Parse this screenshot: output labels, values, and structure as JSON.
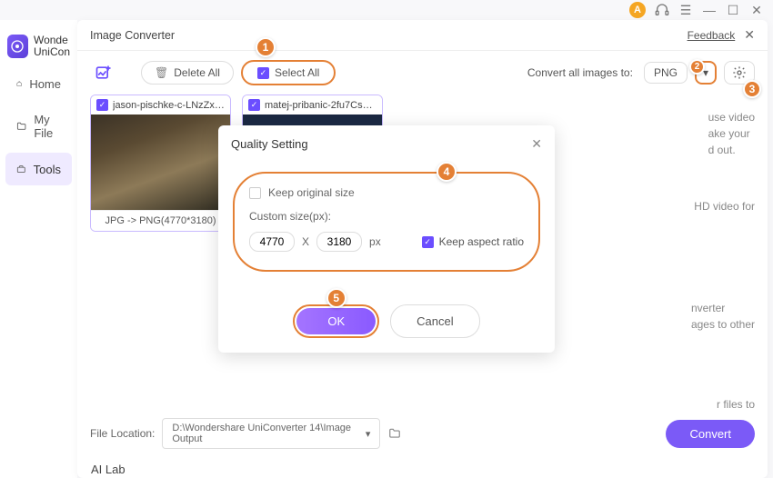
{
  "titlebar": {
    "avatar_letter": "A"
  },
  "brand": {
    "line1": "Wonde",
    "line2": "UniCon"
  },
  "sidebar": [
    {
      "icon": "home",
      "label": "Home"
    },
    {
      "icon": "folder",
      "label": "My File"
    },
    {
      "icon": "tools",
      "label": "Tools"
    }
  ],
  "panel_title": "Image Converter",
  "feedback_label": "Feedback",
  "toolbar": {
    "delete_all": "Delete All",
    "select_all": "Select All",
    "convert_label": "Convert all images to:",
    "format": "PNG"
  },
  "thumbs": [
    {
      "name": "jason-pischke-c-LNzZxJtZ...",
      "footer": "JPG -> PNG(4770*3180)"
    },
    {
      "name": "matej-pribanic-2fu7CskIT..."
    }
  ],
  "hints": {
    "h1": "use video\nake your\nd out.",
    "h2": "HD video for",
    "h3": "nverter\nages to other",
    "h4": "r files to"
  },
  "modal": {
    "title": "Quality Setting",
    "keep_original": "Keep original size",
    "custom_label": "Custom size(px):",
    "width": "4770",
    "height": "3180",
    "x": "X",
    "px": "px",
    "keep_ratio": "Keep aspect ratio",
    "ok": "OK",
    "cancel": "Cancel"
  },
  "bottom": {
    "label": "File Location:",
    "path": "D:\\Wondershare UniConverter 14\\Image Output",
    "convert": "Convert"
  },
  "ai_lab": "AI Lab",
  "tags": {
    "t1": "1",
    "t2": "2",
    "t3": "3",
    "t4": "4",
    "t5": "5"
  }
}
